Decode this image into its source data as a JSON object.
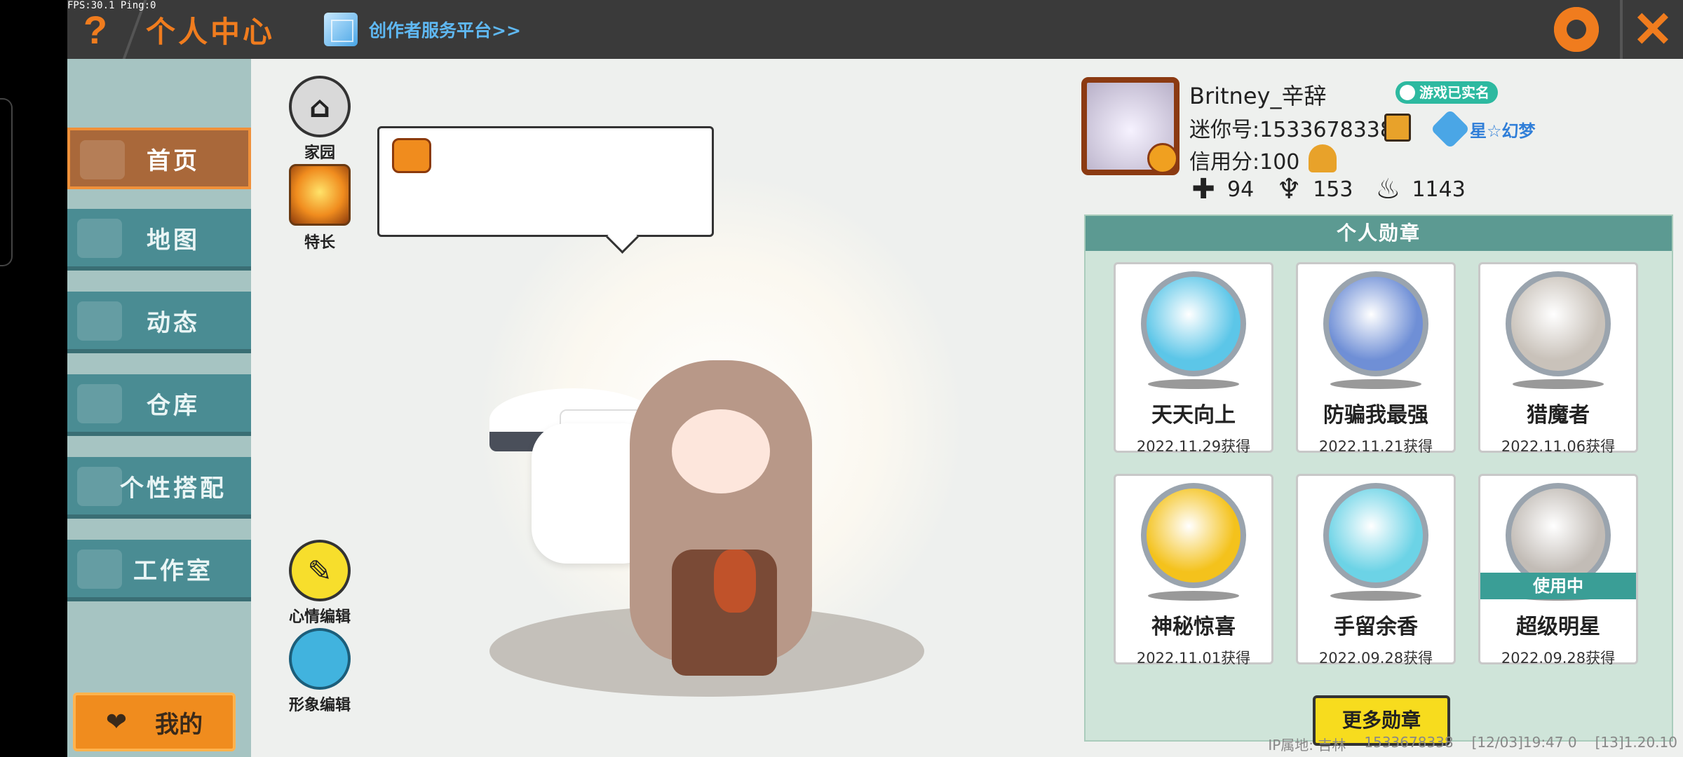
{
  "debug": {
    "fps": "FPS:30.1  Ping:0"
  },
  "header": {
    "help": "?",
    "title": "个人中心",
    "creator_link": "创作者服务平台>>",
    "close": "✕"
  },
  "sidebar": {
    "items": [
      {
        "label": "首页",
        "active": true
      },
      {
        "label": "地图"
      },
      {
        "label": "动态"
      },
      {
        "label": "仓库"
      },
      {
        "label": "个性搭配"
      },
      {
        "label": "工作室"
      }
    ],
    "mine": "我的",
    "mine_icon": "heart-icon"
  },
  "stage": {
    "home_label": "家园",
    "skill_label": "特长",
    "mood_label": "心情编辑",
    "avatar_label": "形象编辑"
  },
  "profile": {
    "name": "Britney_辛辞",
    "verified": "游戏已实名",
    "mini_id": "迷你号:1533678338",
    "rank": "星☆幻梦",
    "credit": "信用分:100",
    "stats": [
      {
        "icon": "plus-icon",
        "value": "94"
      },
      {
        "icon": "cheer-icon",
        "value": "153"
      },
      {
        "icon": "flame-icon",
        "value": "1143"
      }
    ]
  },
  "medals": {
    "title": "个人勋章",
    "items": [
      {
        "name": "天天向上",
        "date": "2022.11.29获得",
        "color": "#5cc6e8",
        "in_use": false
      },
      {
        "name": "防骗我最强",
        "date": "2022.11.21获得",
        "color": "#6f8fd6",
        "in_use": false
      },
      {
        "name": "猎魔者",
        "date": "2022.11.06获得",
        "color": "#c9c2ba",
        "in_use": false
      },
      {
        "name": "神秘惊喜",
        "date": "2022.11.01获得",
        "color": "#f4c21c",
        "in_use": false
      },
      {
        "name": "手留余香",
        "date": "2022.09.28获得",
        "color": "#6cd3e6",
        "in_use": false
      },
      {
        "name": "超级明星",
        "date": "2022.09.28获得",
        "color": "#c2bcb6",
        "in_use": true
      }
    ],
    "in_use_label": "使用中",
    "more": "更多勋章"
  },
  "footer": {
    "ip": "IP属地: 吉林",
    "id": "1533678338",
    "time": "[12/03]19:47 0",
    "version": "[13]1.20.10"
  }
}
